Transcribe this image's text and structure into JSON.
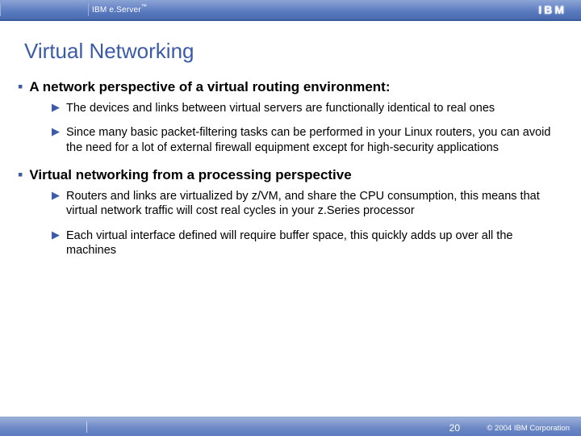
{
  "header": {
    "brand_prefix": "IBM e.",
    "brand_mid": "Server",
    "brand_tm": "™",
    "logo_text": "IBM"
  },
  "title": "Virtual Networking",
  "bullets": {
    "b1": {
      "text": "A network perspective of a virtual routing environment:",
      "sub": {
        "s1": "The devices and links between virtual servers are functionally identical to real ones",
        "s2": "Since many basic packet-filtering tasks can be performed in your Linux routers, you can avoid the need for a lot of external firewall equipment except for high-security applications"
      }
    },
    "b2": {
      "text": "Virtual networking from a processing perspective",
      "sub": {
        "s1": "Routers and links are virtualized by z/VM, and share the CPU consumption, this means that virtual network traffic will cost real cycles in your z.Series processor",
        "s2": "Each virtual interface defined will require buffer space, this quickly adds up over all the machines"
      }
    }
  },
  "footer": {
    "page": "20",
    "copyright": "© 2004 IBM Corporation"
  }
}
